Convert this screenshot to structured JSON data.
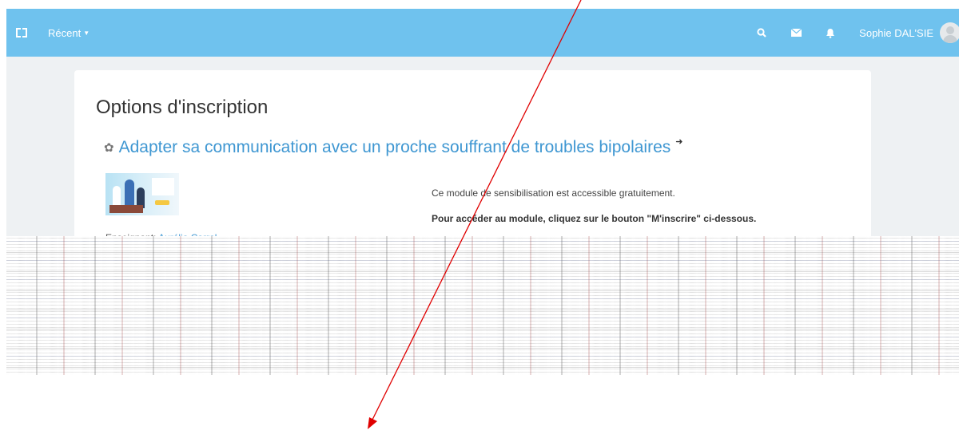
{
  "navbar": {
    "expand_icon": "expand-icon",
    "recent_label": "Récent",
    "search_icon": "search-icon",
    "messages_icon": "envelope-icon",
    "notifications_icon": "bell-icon",
    "user_name": "Sophie DAL'SIE",
    "color": "#6fc2ee"
  },
  "main": {
    "page_title": "Options d'inscription",
    "course_title": "Adapter sa communication avec un proche souffrant de troubles bipolaires",
    "teacher_label": "Enseignant: ",
    "teacher_name": "Aurélia Carral",
    "description": "Ce module de sensibilisation est accessible gratuitement.",
    "instruction": "Pour accéder au module, cliquez sur le bouton \"M'inscrire\" ci-dessous."
  },
  "annotation": {
    "arrow_color": "#e00000"
  },
  "colors": {
    "link": "#3f97d2",
    "page_bg": "#eef1f3"
  }
}
